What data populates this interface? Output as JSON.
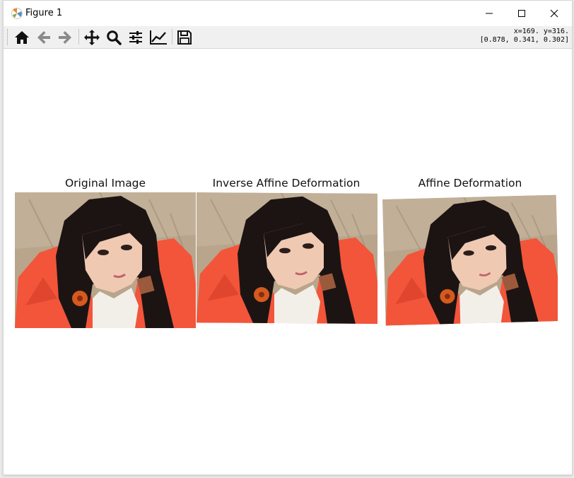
{
  "window": {
    "title": "Figure 1"
  },
  "toolbar": {
    "buttons": [
      {
        "name": "home-icon",
        "label": "Home"
      },
      {
        "name": "back-arrow-icon",
        "label": "Back"
      },
      {
        "name": "forward-arrow-icon",
        "label": "Forward"
      },
      {
        "name": "pan-icon",
        "label": "Pan"
      },
      {
        "name": "zoom-icon",
        "label": "Zoom"
      },
      {
        "name": "subplots-icon",
        "label": "Configure subplots"
      },
      {
        "name": "edit-axis-icon",
        "label": "Edit axis"
      },
      {
        "name": "save-icon",
        "label": "Save"
      }
    ],
    "coord_line1": "x=169. y=316.",
    "coord_line2": "[0.878, 0.341, 0.302]"
  },
  "figure": {
    "panels": [
      {
        "title": "Original Image"
      },
      {
        "title": "Inverse Affine Deformation"
      },
      {
        "title": "Affine Deformation"
      }
    ]
  },
  "colors": {
    "jacket": "#f2553a",
    "hair": "#1c1413",
    "skin": "#f0c9b2",
    "background_grass": "#b8a58c",
    "scarf": "#f2efe9"
  }
}
